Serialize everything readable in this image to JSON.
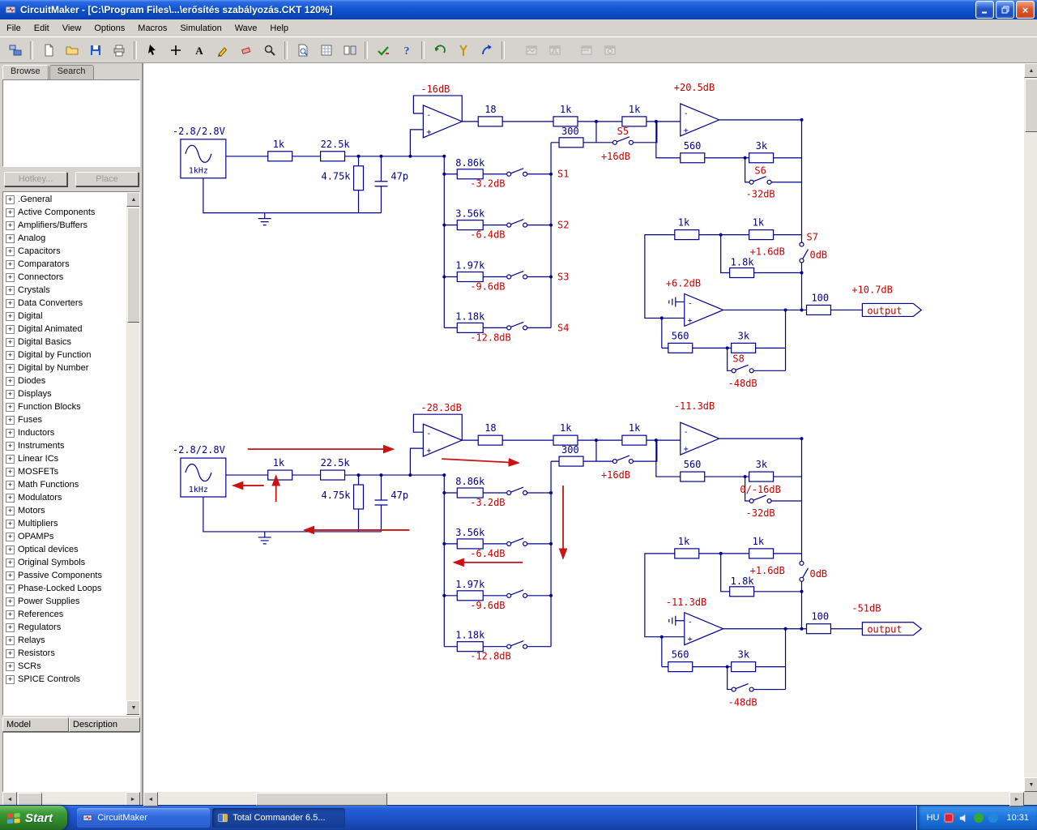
{
  "window": {
    "title": "CircuitMaker - [C:\\Program Files\\...\\erősítés szabályozás.CKT 120%]"
  },
  "glyphs": {
    "plus": "+",
    "minus": "-",
    "up": "▲",
    "down": "▼",
    "left": "◄",
    "right": "►",
    "close": "×"
  },
  "menu_bar": {
    "items": [
      "File",
      "Edit",
      "View",
      "Options",
      "Macros",
      "Simulation",
      "Wave",
      "Help"
    ]
  },
  "sidebar": {
    "tab_browse": "Browse",
    "tab_search": "Search",
    "hotkey_button": "Hotkey...",
    "place_button": "Place",
    "categories": [
      ".General",
      "Active Components",
      "Amplifiers/Buffers",
      "Analog",
      "Capacitors",
      "Comparators",
      "Connectors",
      "Crystals",
      "Data Converters",
      "Digital",
      "Digital Animated",
      "Digital Basics",
      "Digital by Function",
      "Digital by Number",
      "Diodes",
      "Displays",
      "Function Blocks",
      "Fuses",
      "Inductors",
      "Instruments",
      "Linear ICs",
      "MOSFETs",
      "Math Functions",
      "Modulators",
      "Motors",
      "Multipliers",
      "OPAMPs",
      "Optical devices",
      "Original Symbols",
      "Passive Components",
      "Phase-Locked Loops",
      "Power Supplies",
      "References",
      "Regulators",
      "Relays",
      "Resistors",
      "SCRs",
      "SPICE Controls"
    ],
    "model_header": "Model",
    "description_header": "Description"
  },
  "taskbar": {
    "start_label": "Start",
    "tasks": [
      {
        "label": "CircuitMaker"
      },
      {
        "label": "Total Commander 6.5..."
      }
    ],
    "language": "HU",
    "clock": "10:31"
  },
  "colors": {
    "wire": "#00008c",
    "annotation": "#cc0000"
  },
  "circuits": {
    "top": {
      "source_voltage": "-2.8/2.8V",
      "source_freq": "1kHz",
      "r_in1": "1k",
      "r_in2": "22.5k",
      "r_shunt": "4.75k",
      "cap": "47p",
      "stage1_gain": "-16dB",
      "r_a": "18",
      "r_b": "1k",
      "r_c": "1k",
      "r_300": "300",
      "sw5": "S5",
      "sw5_gain": "+16dB",
      "stage2_gain": "+20.5dB",
      "fb1_r1": "560",
      "fb1_r2": "3k",
      "sw6": "S6",
      "sw6_gain": "-32dB",
      "ladder": [
        {
          "r": "8.86k",
          "db": "-3.2dB",
          "sw": "S1"
        },
        {
          "r": "3.56k",
          "db": "-6.4dB",
          "sw": "S2"
        },
        {
          "r": "1.97k",
          "db": "-9.6dB",
          "sw": "S3"
        },
        {
          "r": "1.18k",
          "db": "-12.8dB",
          "sw": "S4"
        }
      ],
      "att_r1": "1k",
      "att_r2": "1k",
      "att_r3": "1.8k",
      "sw7": "S7",
      "sw7_db_a": "+1.6dB",
      "sw7_db_b": "0dB",
      "stage3_gain": "+6.2dB",
      "fb2_r1": "560",
      "fb2_r2": "3k",
      "sw8": "S8",
      "sw8_gain": "-48dB",
      "r_out": "100",
      "out_level": "+10.7dB",
      "out_tag": "output"
    },
    "bottom": {
      "source_voltage": "-2.8/2.8V",
      "source_freq": "1kHz",
      "r_in1": "1k",
      "r_in2": "22.5k",
      "r_shunt": "4.75k",
      "cap": "47p",
      "stage1_gain": "-28.3dB",
      "r_a": "18",
      "r_b": "1k",
      "r_c": "1k",
      "r_300": "300",
      "sw5": "",
      "sw5_gain": "+16dB",
      "stage2_gain": "-11.3dB",
      "fb1_r1": "560",
      "fb1_r2": "3k",
      "sw6": "0/-16dB",
      "sw6_gain": "-32dB",
      "ladder": [
        {
          "r": "8.86k",
          "db": "-3.2dB",
          "sw": ""
        },
        {
          "r": "3.56k",
          "db": "-6.4dB",
          "sw": ""
        },
        {
          "r": "1.97k",
          "db": "-9.6dB",
          "sw": ""
        },
        {
          "r": "1.18k",
          "db": "-12.8dB",
          "sw": ""
        }
      ],
      "att_r1": "1k",
      "att_r2": "1k",
      "att_r3": "1.8k",
      "sw7": "",
      "sw7_db_a": "+1.6dB",
      "sw7_db_b": "0dB",
      "stage3_gain": "-11.3dB",
      "fb2_r1": "560",
      "fb2_r2": "3k",
      "sw8": "",
      "sw8_gain": "-48dB",
      "r_out": "100",
      "out_level": "-51dB",
      "out_tag": "output"
    }
  },
  "toolbar": {
    "buttons": [
      "library",
      "new",
      "open",
      "save",
      "print",
      "cursor",
      "add-part",
      "text",
      "wire",
      "erase",
      "zoom",
      "sheet-zoom",
      "grid",
      "split",
      "simulate",
      "help",
      "reset",
      "probe",
      "run",
      "scope-1",
      "scope-2",
      "scope-3",
      "scope-4"
    ]
  }
}
